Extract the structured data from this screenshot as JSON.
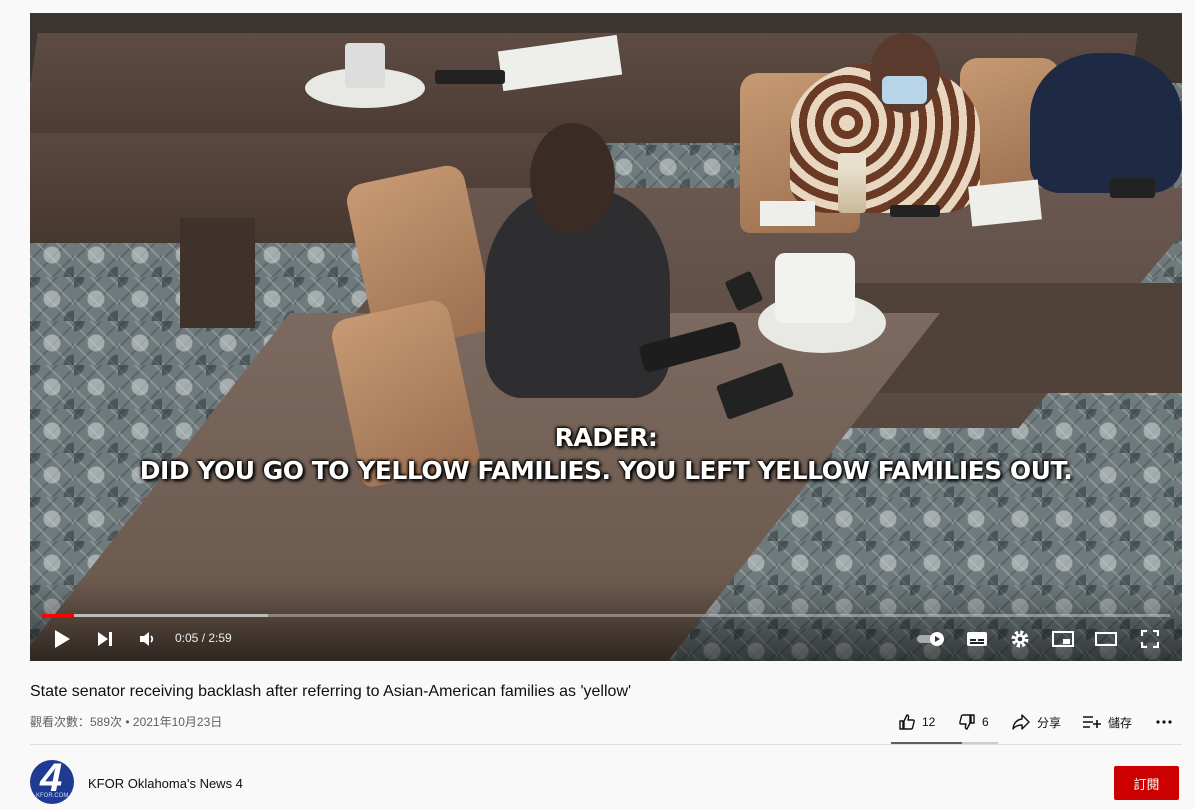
{
  "player": {
    "caption_line1": "RADER:",
    "caption_line2": "DID YOU GO TO YELLOW FAMILIES. YOU LEFT YELLOW FAMILIES OUT.",
    "time_display": "0:05 / 2:59",
    "progress_played_fraction": 0.028,
    "progress_buffered_fraction": 0.2,
    "progress_color": "#ff0000"
  },
  "video": {
    "title": "State senator receiving backlash after referring to Asian-American families as 'yellow'",
    "meta": "觀看次數：589次 • 2021年10月23日"
  },
  "actions": {
    "like_count": "12",
    "dislike_count": "6",
    "share_label": "分享",
    "save_label": "儲存",
    "like_fraction": 0.667
  },
  "channel": {
    "name": "KFOR Oklahoma's News 4",
    "avatar_text": "4",
    "avatar_subtext": "KFOR.COM",
    "subscribe_label": "訂閱",
    "subscribe_color": "#cc0000"
  }
}
